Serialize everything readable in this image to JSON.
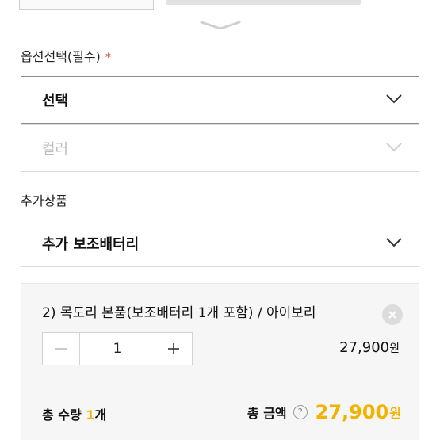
{
  "options": {
    "label": "옵션선택(필수)",
    "required_mark": "*",
    "primary_select": {
      "value": "선택"
    },
    "secondary_select": {
      "value": "컬러"
    }
  },
  "addon": {
    "label": "추가상품",
    "select": {
      "value": "추가 보조배터리"
    }
  },
  "selected_item": {
    "name": "2) 목도리 본품(보조배터리 1개 포함) / 아이보리",
    "quantity": "1",
    "price": "27,900",
    "price_unit": "원"
  },
  "summary": {
    "qty_label": "총 수량",
    "qty_value": "1",
    "qty_unit": "개",
    "amount_label": "총 금액",
    "help_symbol": "?",
    "total": "27,900",
    "total_unit": "원"
  },
  "colors": {
    "accent": "#f2b300",
    "required": "#e2452c",
    "panel_bg": "#f6f6f6"
  },
  "icons": [
    "collapse-handle-icon",
    "chevron-down-icon",
    "close-icon",
    "minus-icon",
    "plus-icon",
    "help-icon"
  ]
}
